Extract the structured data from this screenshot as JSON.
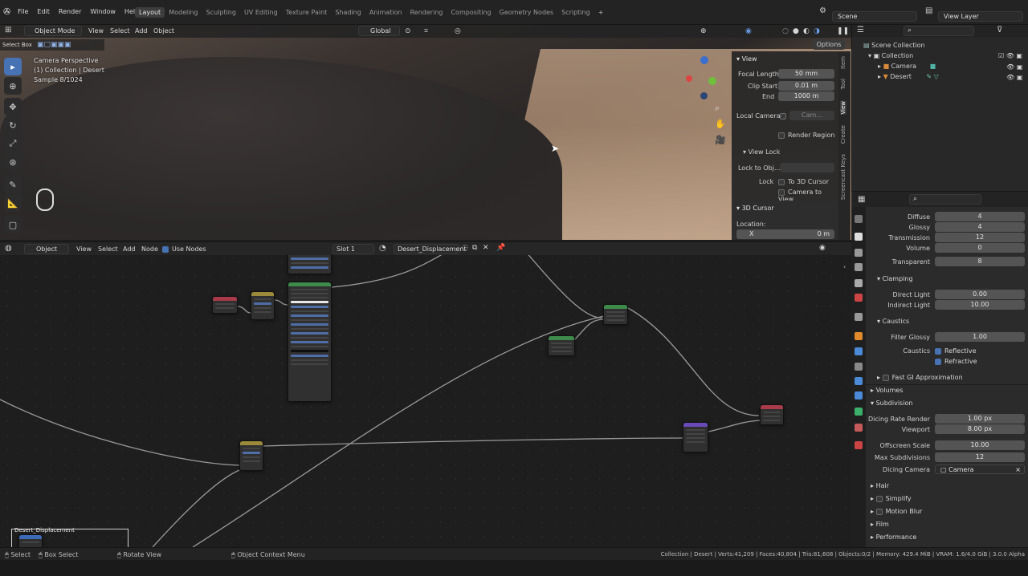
{
  "menu": [
    "File",
    "Edit",
    "Render",
    "Window",
    "Help"
  ],
  "workspaces": [
    "Layout",
    "Modeling",
    "Sculpting",
    "UV Editing",
    "Texture Paint",
    "Shading",
    "Animation",
    "Rendering",
    "Compositing",
    "Geometry Nodes",
    "Scripting"
  ],
  "active_workspace": "Layout",
  "scene": "Scene",
  "view_layer": "View Layer",
  "viewport": {
    "mode": "Object Mode",
    "menus": [
      "View",
      "Select",
      "Add",
      "Object"
    ],
    "orientation": "Global",
    "select_box": "Select Box",
    "options": "Options",
    "overlay": [
      "Camera Perspective",
      "(1) Collection | Desert",
      "Sample 8/1024"
    ]
  },
  "npanel": {
    "view_title": "View",
    "focal_length_label": "Focal Length",
    "focal_length": "50 mm",
    "clip_start_label": "Clip Start",
    "clip_start": "0.01 m",
    "end_label": "End",
    "end": "1000 m",
    "local_camera": "Local Camera",
    "local_camera_value": "Cam...",
    "render_region": "Render Region",
    "view_lock": "View Lock",
    "lock_to_obj": "Lock to Obj...",
    "lock": "Lock",
    "to_3d_cursor": "To 3D Cursor",
    "camera_to_view": "Camera to View",
    "cursor_title": "3D Cursor",
    "location": "Location:",
    "x_label": "X",
    "x_value": "0 m",
    "tabs": [
      "Item",
      "Tool",
      "View",
      "Create",
      "Screencast Keys"
    ]
  },
  "outliner": {
    "scene_collection": "Scene Collection",
    "collection": "Collection",
    "items": [
      "Camera",
      "Desert"
    ]
  },
  "properties": {
    "diffuse_label": "Diffuse",
    "diffuse": "4",
    "glossy_label": "Glossy",
    "glossy": "4",
    "transmission_label": "Transmission",
    "transmission": "12",
    "volume_label": "Volume",
    "volume": "0",
    "transparent_label": "Transparent",
    "transparent": "8",
    "clamping": "Clamping",
    "direct_light_label": "Direct Light",
    "direct_light": "0.00",
    "indirect_light_label": "Indirect Light",
    "indirect_light": "10.00",
    "caustics": "Caustics",
    "filter_glossy_label": "Filter Glossy",
    "filter_glossy": "1.00",
    "caustics_label": "Caustics",
    "reflective": "Reflective",
    "refractive": "Refractive",
    "fast_gi": "Fast GI Approximation",
    "volumes": "Volumes",
    "subdivision": "Subdivision",
    "dicing_rate_label": "Dicing Rate Render",
    "dicing_rate": "1.00 px",
    "viewport_label": "Viewport",
    "viewport": "8.00 px",
    "offscreen_label": "Offscreen Scale",
    "offscreen": "10.00",
    "max_subdiv_label": "Max Subdivisions",
    "max_subdiv": "12",
    "dicing_camera_label": "Dicing Camera",
    "dicing_camera": "Camera",
    "hair": "Hair",
    "simplify": "Simplify",
    "motion_blur": "Motion Blur",
    "film": "Film",
    "performance": "Performance"
  },
  "node_editor": {
    "type": "Object",
    "menus": [
      "View",
      "Select",
      "Add",
      "Node"
    ],
    "use_nodes": "Use Nodes",
    "slot": "Slot 1",
    "material": "Desert_Displacement",
    "frame_label": "Desert_Displacement"
  },
  "status": {
    "select": "Select",
    "box_select": "Box Select",
    "rotate_view": "Rotate View",
    "context_menu": "Object Context Menu",
    "stats": "Collection | Desert | Verts:41,209 | Faces:40,804 | Tris:81,608 | Objects:0/2 | Memory: 429.4 MiB | VRAM: 1.6/4.0 GiB | 3.0.0 Alpha"
  }
}
